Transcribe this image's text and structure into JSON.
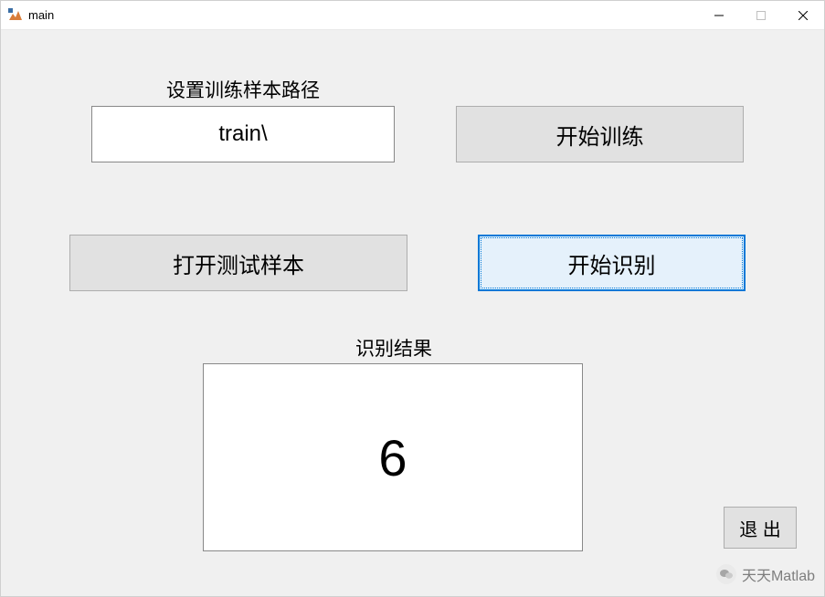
{
  "window": {
    "title": "main"
  },
  "labels": {
    "train_path": "设置训练样本路径",
    "result": "识别结果"
  },
  "inputs": {
    "train_path_value": "train\\"
  },
  "buttons": {
    "start_train": "开始训练",
    "open_test": "打开测试样本",
    "start_recognize": "开始识别",
    "exit": "退 出"
  },
  "result": {
    "value": "6"
  },
  "watermark": {
    "text": "天天Matlab"
  }
}
